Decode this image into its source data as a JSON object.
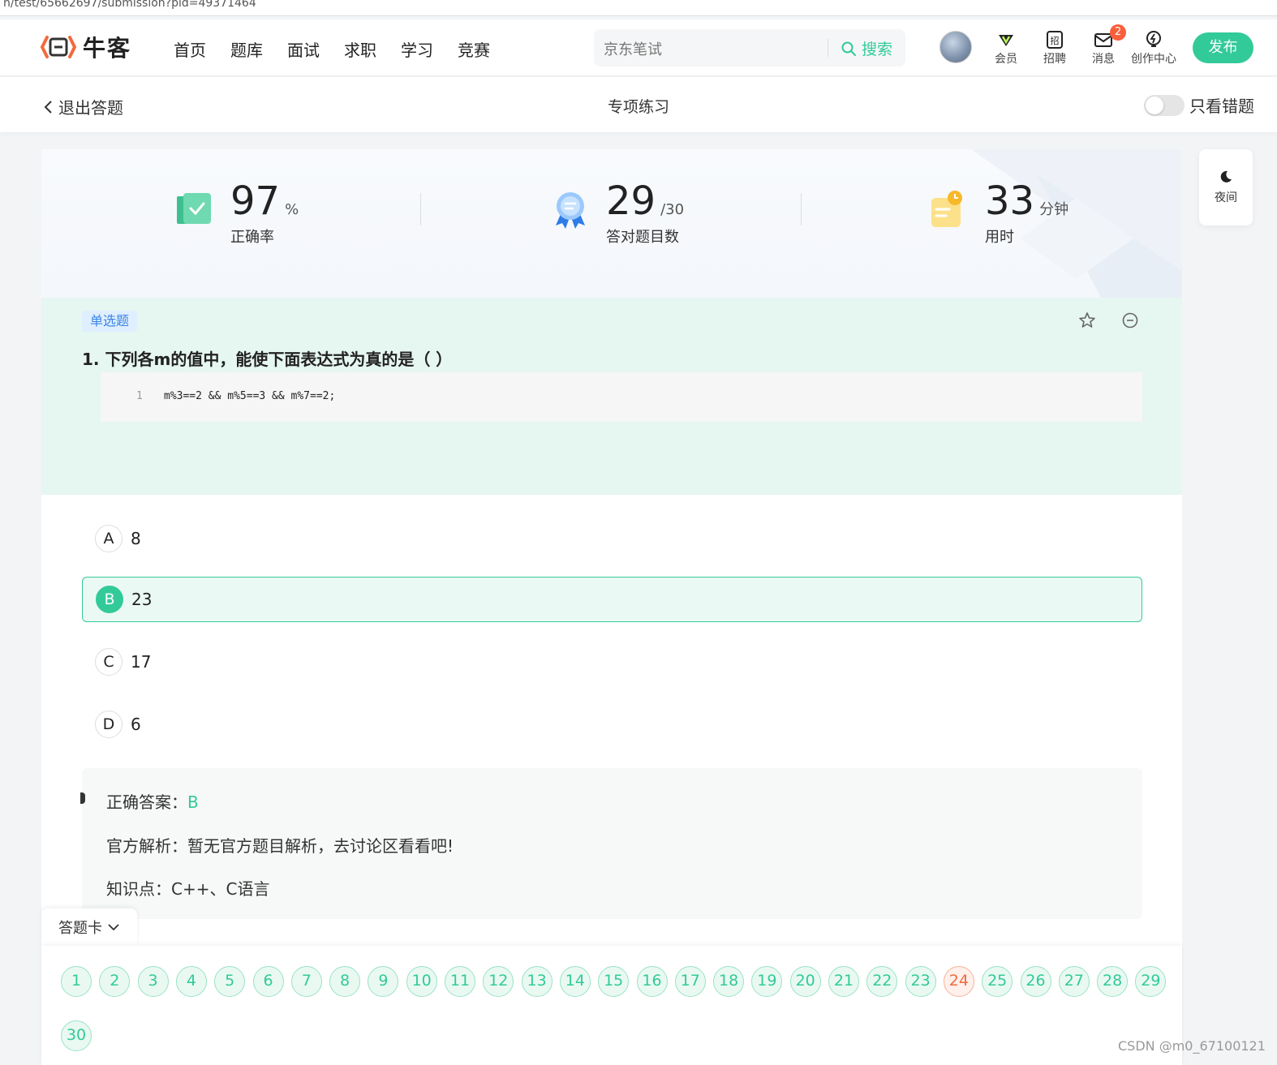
{
  "url": "n/test/65662697/submission?pid=49371464",
  "brand": {
    "name": "牛客",
    "accent": "#32ca99"
  },
  "nav": {
    "menu": [
      "首页",
      "题库",
      "面试",
      "求职",
      "学习",
      "竞赛"
    ],
    "search_placeholder": "京东笔试",
    "search_button": "搜索",
    "icons": [
      {
        "name": "vip-icon",
        "label": "会员"
      },
      {
        "name": "recruit-icon",
        "label": "招聘"
      },
      {
        "name": "message-icon",
        "label": "消息",
        "badge": "2"
      },
      {
        "name": "creator-icon",
        "label": "创作中心"
      }
    ],
    "publish": "发布"
  },
  "subbar": {
    "back": "退出答题",
    "title": "专项练习",
    "toggle_label": "只看错题"
  },
  "night": {
    "label": "夜间"
  },
  "stats": [
    {
      "value": "97",
      "unit": "%",
      "label": "正确率"
    },
    {
      "value": "29",
      "unit": "/30",
      "label": "答对题目数"
    },
    {
      "value": "33",
      "unit": "分钟",
      "label": "用时"
    }
  ],
  "question": {
    "type": "单选题",
    "title": "1. 下列各m的值中，能使下面表达式为真的是（ ）",
    "code_line_no": "1",
    "code": "m%3==2 && m%5==3 && m%7==2;"
  },
  "options": [
    {
      "letter": "A",
      "text": "8",
      "selected": false
    },
    {
      "letter": "B",
      "text": "23",
      "selected": true
    },
    {
      "letter": "C",
      "text": "17",
      "selected": false
    },
    {
      "letter": "D",
      "text": "6",
      "selected": false
    }
  ],
  "answer": {
    "correct_label": "正确答案：",
    "correct_value": "B",
    "analysis": "官方解析：暂无官方题目解析，去讨论区看看吧!",
    "knowledge": "知识点：C++、C语言"
  },
  "card": {
    "label": "答题卡",
    "numbers": [
      "1",
      "2",
      "3",
      "4",
      "5",
      "6",
      "7",
      "8",
      "9",
      "10",
      "11",
      "12",
      "13",
      "14",
      "15",
      "16",
      "17",
      "18",
      "19",
      "20",
      "21",
      "22",
      "23",
      "24",
      "25",
      "26",
      "27",
      "28",
      "29",
      "30"
    ],
    "wrong": [
      "24"
    ]
  },
  "watermark": "CSDN @m0_67100121"
}
